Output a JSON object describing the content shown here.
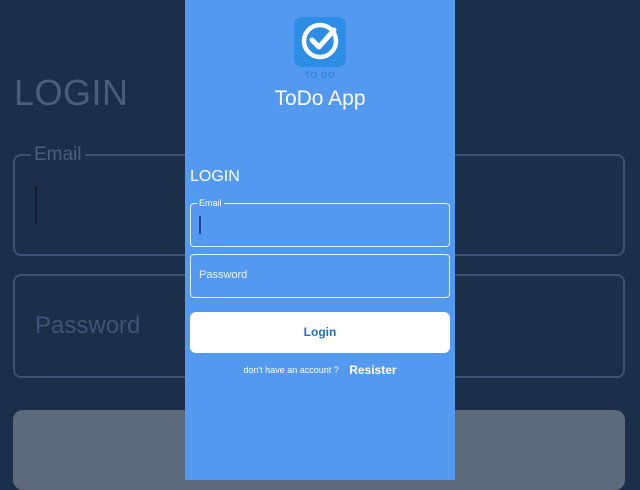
{
  "background": {
    "title": "LOGIN",
    "email_label": "Email",
    "password_placeholder": "Password"
  },
  "app": {
    "logo_text": "TO DO",
    "title": "ToDo App"
  },
  "form": {
    "heading": "LOGIN",
    "email_label": "Email",
    "email_value": "",
    "password_placeholder": "Password",
    "login_label": "Login",
    "no_account_text": "don't have an account ?",
    "register_label": "Resister"
  },
  "colors": {
    "panel": "#5399ef",
    "backdrop": "#1c2f4a",
    "logo_bg": "#2d8de4",
    "button_text": "#1f6fc2"
  },
  "icons": [
    "checkmark-icon"
  ]
}
